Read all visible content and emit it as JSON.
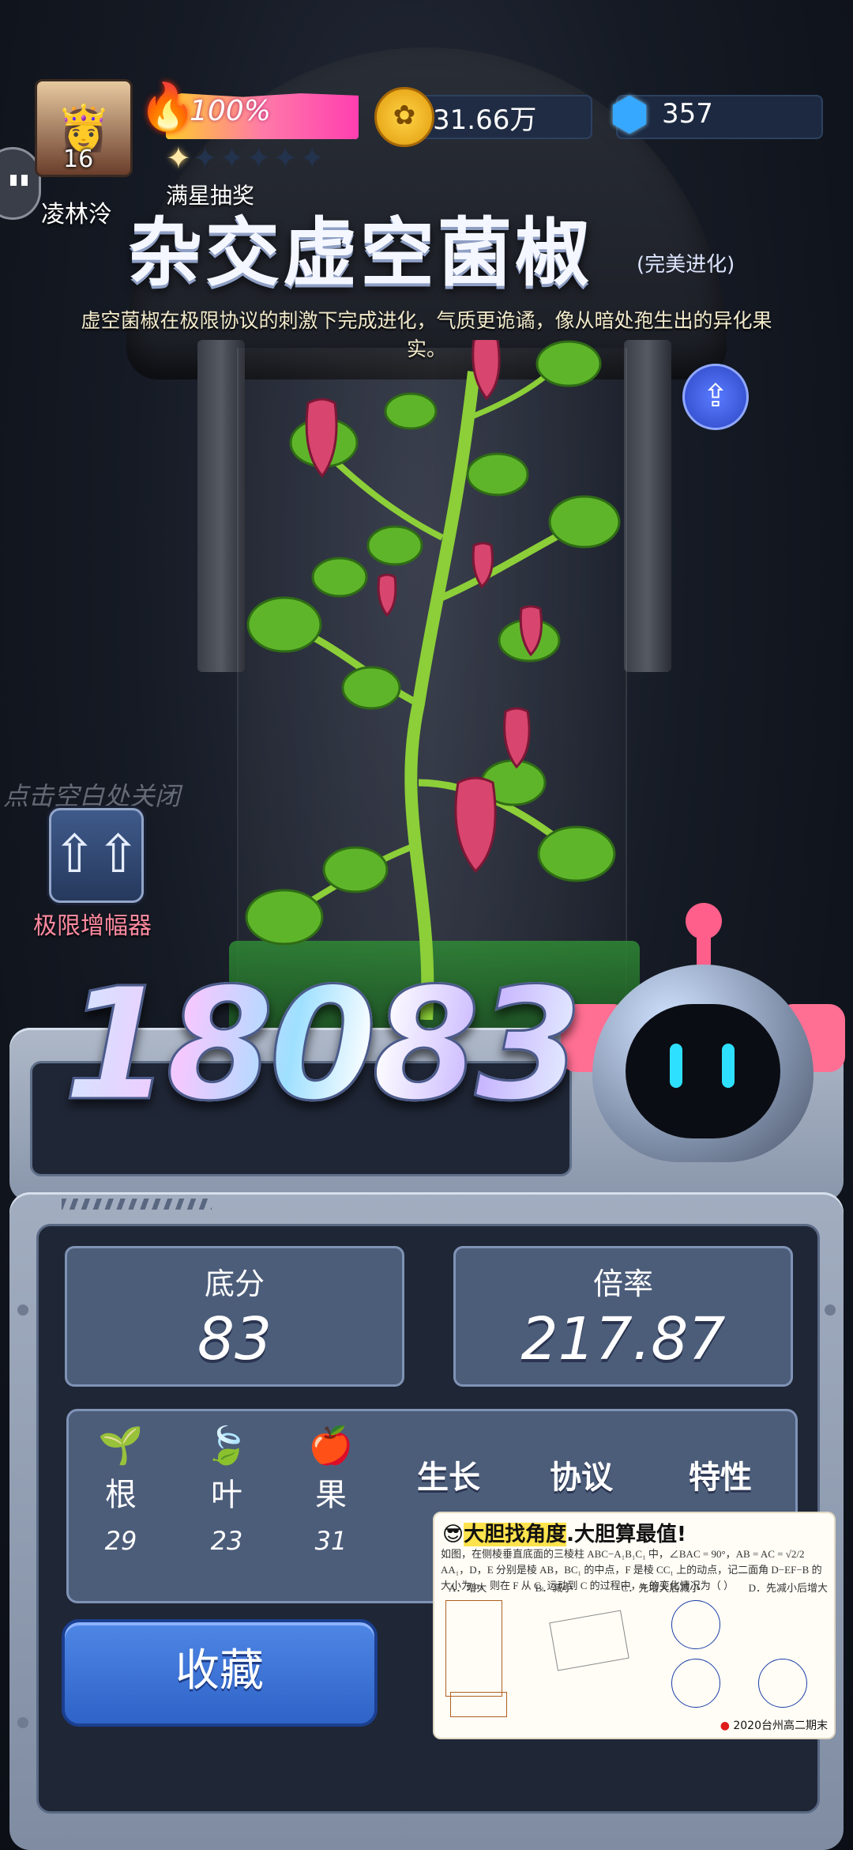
{
  "player": {
    "name": "凌林泠",
    "level": "16"
  },
  "energy": {
    "percent_label": "100%",
    "percent": 100
  },
  "stars": {
    "filled": 1,
    "total": 6,
    "label": "满星抽奖"
  },
  "resources": {
    "coins": "31.66万",
    "gems": "357"
  },
  "title": {
    "name": "杂交虚空菌椒",
    "suffix": "(完美进化)",
    "description": "虚空菌椒在极限协议的刺激下完成进化，气质更诡谲，像从暗处孢生出的异化果实。"
  },
  "hints": {
    "close": "点击空白处关闭"
  },
  "booster": {
    "label": "极限增幅器"
  },
  "score": "18083",
  "stats": {
    "base_label": "底分",
    "base_value": "83",
    "multiplier_label": "倍率",
    "multiplier_value": "217.87"
  },
  "parts": [
    {
      "label": "根",
      "value": "29",
      "icon": "root-icon"
    },
    {
      "label": "叶",
      "value": "23",
      "icon": "leaf-icon"
    },
    {
      "label": "果",
      "value": "31",
      "icon": "fruit-icon"
    }
  ],
  "tags": [
    "生长",
    "协议",
    "特性"
  ],
  "collect": {
    "label": "收藏"
  },
  "ad": {
    "title_prefix": "😎",
    "title_part1": "大胆找角度",
    "title_part2": "大胆算最值!",
    "text": "如图，在侧棱垂直底面的三棱柱 ABC−A₁B₁C₁ 中，∠BAC = 90°，AB = AC = √2/2 AA₁，D，E 分别是棱 AB，BC₁ 的中点，F 是棱 CC₁ 上的动点，记二面角 D−EF−B 的大小为 α，则在 F 从 C₁ 运动到 C 的过程中，α 的变化情况为（ ）",
    "options": [
      "A．增大",
      "B．减小",
      "C．先增大后减小",
      "D．先减小后增大"
    ],
    "footer": "2020台州高二期末"
  },
  "colors": {
    "accent_blue": "#2f63c7",
    "score_gradient": [
      "#cfe9ff",
      "#f3c8ff",
      "#9fe0ff"
    ],
    "part_label_pink": "#ff8aa0"
  }
}
